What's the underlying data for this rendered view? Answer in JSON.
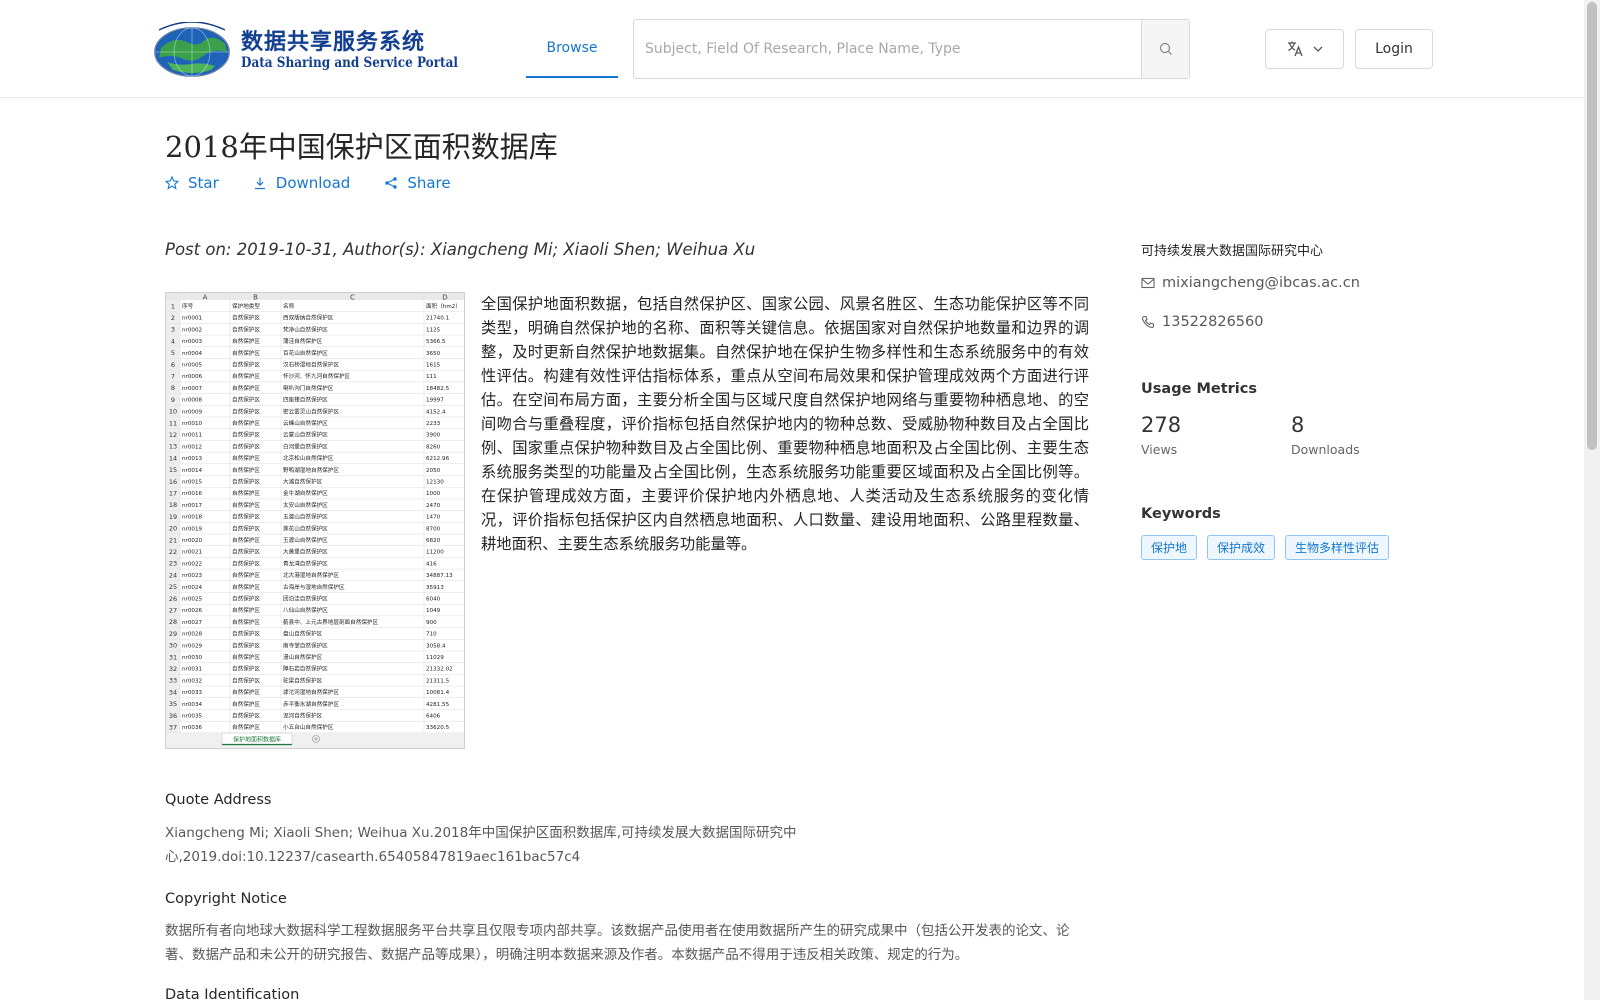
{
  "header": {
    "logo_cn": "数据共享服务系统",
    "logo_en": "Data Sharing and Service Portal",
    "nav_browse": "Browse",
    "search_placeholder": "Subject, Field Of Research, Place Name, Type",
    "login_label": "Login"
  },
  "dataset": {
    "title": "2018年中国保护区面积数据库",
    "actions": {
      "star": "Star",
      "download": "Download",
      "share": "Share"
    },
    "post_line": "Post on: 2019-10-31, Author(s): Xiangcheng Mi; Xiaoli Shen; Weihua Xu",
    "description": "全国保护地面积数据，包括自然保护区、国家公园、风景名胜区、生态功能保护区等不同类型，明确自然保护地的名称、面积等关键信息。依据国家对自然保护地数量和边界的调整，及时更新自然保护地数据集。自然保护地在保护生物多样性和生态系统服务中的有效性评估。构建有效性评估指标体系，重点从空间布局效果和保护管理成效两个方面进行评估。在空间布局方面，主要分析全国与区域尺度自然保护地网络与重要物种栖息地、的空间吻合与重叠程度，评价指标包括自然保护地内的物种总数、受威胁物种数目及占全国比例、国家重点保护物种数目及占全国比例、重要物种栖息地面积及占全国比例、主要生态系统服务类型的功能量及占全国比例，生态系统服务功能重要区域面积及占全国比例等。在保护管理成效方面，主要评价保护地内外栖息地、人类活动及生态系统服务的变化情况，评价指标包括保护区内自然栖息地面积、人口数量、建设用地面积、公路里程数量、耕地面积、主要生态系统服务功能量等。"
  },
  "preview_sheet": {
    "col_letters": [
      "A",
      "B",
      "C",
      "D"
    ],
    "headers": [
      "序号",
      "保护地类型",
      "名称",
      "面积（hm2）"
    ],
    "rows": [
      [
        "nr0001",
        "自然保护区",
        "西双版纳自然保护区",
        "21740.1"
      ],
      [
        "nr0002",
        "自然保护区",
        "梵净山自然保护区",
        "1125"
      ],
      [
        "nr0003",
        "自然保护区",
        "蒲洼自然保护区",
        "5366.5"
      ],
      [
        "nr0004",
        "自然保护区",
        "百花山自然保护区",
        "3650"
      ],
      [
        "nr0005",
        "自然保护区",
        "汉石桥湿地自然保护区",
        "1615"
      ],
      [
        "nr0006",
        "自然保护区",
        "怀沙河、怀九河自然保护区",
        "111"
      ],
      [
        "nr0007",
        "自然保护区",
        "喇叭沟门自然保护区",
        "18482.5"
      ],
      [
        "nr0008",
        "自然保护区",
        "四座楼自然保护区",
        "19997"
      ],
      [
        "nr0009",
        "自然保护区",
        "密云雾灵山自然保护区",
        "4152.4"
      ],
      [
        "nr0010",
        "自然保护区",
        "云峰山自然保护区",
        "2233"
      ],
      [
        "nr0011",
        "自然保护区",
        "云蒙山自然保护区",
        "3900"
      ],
      [
        "nr0012",
        "自然保护区",
        "白河堡自然保护区",
        "8260"
      ],
      [
        "nr0013",
        "自然保护区",
        "北京松山自然保护区",
        "6212.96"
      ],
      [
        "nr0014",
        "自然保护区",
        "野鸭湖湿地自然保护区",
        "2050"
      ],
      [
        "nr0015",
        "自然保护区",
        "大滩自然保护区",
        "12130"
      ],
      [
        "nr0016",
        "自然保护区",
        "金牛湖自然保护区",
        "1000"
      ],
      [
        "nr0017",
        "自然保护区",
        "太安山自然保护区",
        "2470"
      ],
      [
        "nr0018",
        "自然保护区",
        "玉渡山自然保护区",
        "1470"
      ],
      [
        "nr0019",
        "自然保护区",
        "莲花山自然保护区",
        "8700"
      ],
      [
        "nr0020",
        "自然保护区",
        "玉渡山自然保护区",
        "6820"
      ],
      [
        "nr0021",
        "自然保护区",
        "大黄堡自然保护区",
        "11200"
      ],
      [
        "nr0022",
        "自然保护区",
        "青龙湾自然保护区",
        "416"
      ],
      [
        "nr0023",
        "自然保护区",
        "北大港湿地自然保护区",
        "34887.13"
      ],
      [
        "nr0024",
        "自然保护区",
        "古海岸与湿地自然保护区",
        "35913"
      ],
      [
        "nr0025",
        "自然保护区",
        "团泊洼自然保护区",
        "6040"
      ],
      [
        "nr0026",
        "自然保护区",
        "八仙山自然保护区",
        "1049"
      ],
      [
        "nr0027",
        "自然保护区",
        "蓟县中、上元古界地层剖面自然保护区",
        "900"
      ],
      [
        "nr0028",
        "自然保护区",
        "盘山自然保护区",
        "710"
      ],
      [
        "nr0029",
        "自然保护区",
        "南寺掌自然保护区",
        "3058.4"
      ],
      [
        "nr0030",
        "自然保护区",
        "漫山自然保护区",
        "11029"
      ],
      [
        "nr0031",
        "自然保护区",
        "障石岩自然保护区",
        "21332.02"
      ],
      [
        "nr0032",
        "自然保护区",
        "驼梁自然保护区",
        "21311.5"
      ],
      [
        "nr0033",
        "自然保护区",
        "滹沱河湿地自然保护区",
        "10081.4"
      ],
      [
        "nr0034",
        "自然保护区",
        "赤平衡水湖自然保护区",
        "4281.55"
      ],
      [
        "nr0035",
        "自然保护区",
        "泥河自然保护区",
        "6406"
      ],
      [
        "nr0036",
        "自然保护区",
        "小五台山自然保护区",
        "33620.5"
      ]
    ],
    "tab_label": "保护地面积数据库"
  },
  "quote": {
    "title": "Quote Address",
    "text": "Xiangcheng Mi; Xiaoli Shen; Weihua Xu.2018年中国保护区面积数据库,可持续发展大数据国际研究中心,2019.doi:10.12237/casearth.65405847819aec161bac57c4"
  },
  "copyright": {
    "title": "Copyright Notice",
    "text": "数据所有者向地球大数据科学工程数据服务平台共享且仅限专项内部共享。该数据产品使用者在使用数据所产生的研究成果中（包括公开发表的论文、论著、数据产品和未公开的研究报告、数据产品等成果），明确注明本数据来源及作者。本数据产品不得用于违反相关政策、规定的行为。"
  },
  "data_identification": {
    "title": "Data Identification"
  },
  "sidebar": {
    "org": "可持续发展大数据国际研究中心",
    "email": "mixiangcheng@ibcas.ac.cn",
    "phone": "13522826560",
    "usage_title": "Usage Metrics",
    "views": "278",
    "views_label": "Views",
    "downloads": "8",
    "downloads_label": "Downloads",
    "keywords_title": "Keywords",
    "keywords": [
      "保护地",
      "保护成效",
      "生物多样性评估"
    ]
  },
  "colors": {
    "accent": "#1677d2",
    "logo_blue": "#123f8f"
  }
}
